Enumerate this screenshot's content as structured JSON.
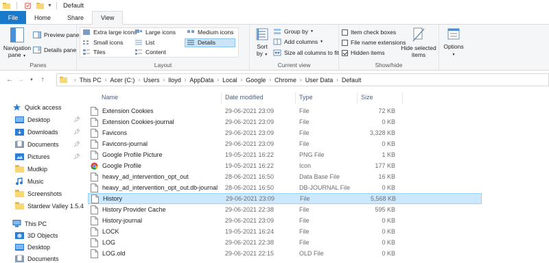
{
  "window": {
    "title": "Default"
  },
  "tabs": {
    "file": "File",
    "home": "Home",
    "share": "Share",
    "view": "View"
  },
  "ribbon": {
    "panes": {
      "label": "Panes",
      "navigation_pane": "Navigation\npane",
      "preview_pane": "Preview pane",
      "details_pane": "Details pane"
    },
    "layout": {
      "label": "Layout",
      "options": [
        "Extra large icons",
        "Large icons",
        "Medium icons",
        "Small icons",
        "List",
        "Details",
        "Tiles",
        "Content"
      ],
      "selected": "Details"
    },
    "current_view": {
      "label": "Current view",
      "sort_by": "Sort\nby",
      "group_by": "Group by",
      "add_columns": "Add columns",
      "size_all_columns": "Size all columns to fit"
    },
    "show_hide": {
      "label": "Show/hide",
      "item_check_boxes": {
        "label": "Item check boxes",
        "checked": false
      },
      "file_name_extensions": {
        "label": "File name extensions",
        "checked": false
      },
      "hidden_items": {
        "label": "Hidden items",
        "checked": true
      },
      "hide_selected_items": "Hide selected\nitems"
    },
    "options": {
      "label": "Options"
    }
  },
  "address": {
    "breadcrumbs": [
      "This PC",
      "Acer (C:)",
      "Users",
      "lloyd",
      "AppData",
      "Local",
      "Google",
      "Chrome",
      "User Data",
      "Default"
    ]
  },
  "nav": {
    "quick_access": "Quick access",
    "items": [
      {
        "label": "Desktop",
        "icon": "desktop-folder-icon",
        "pinned": true
      },
      {
        "label": "Downloads",
        "icon": "downloads-folder-icon",
        "pinned": true
      },
      {
        "label": "Documents",
        "icon": "documents-folder-icon",
        "pinned": true
      },
      {
        "label": "Pictures",
        "icon": "pictures-folder-icon",
        "pinned": true
      },
      {
        "label": "Mudkip",
        "icon": "folder-icon",
        "pinned": false
      },
      {
        "label": "Music",
        "icon": "music-icon",
        "pinned": false
      },
      {
        "label": "Screenshots",
        "icon": "folder-icon",
        "pinned": false
      },
      {
        "label": "Stardew Valley 1.5.4",
        "icon": "folder-icon",
        "pinned": false
      }
    ],
    "this_pc": "This PC",
    "pc_items": [
      {
        "label": "3D Objects",
        "icon": "3d-objects-icon"
      },
      {
        "label": "Desktop",
        "icon": "desktop-folder-icon"
      },
      {
        "label": "Documents",
        "icon": "documents-folder-icon"
      }
    ]
  },
  "columns": {
    "name": "Name",
    "date": "Date modified",
    "type": "Type",
    "size": "Size"
  },
  "files": [
    {
      "name": "Extension Cookies",
      "date": "29-06-2021 23:09",
      "type": "File",
      "size": "72 KB",
      "icon": "file-icon"
    },
    {
      "name": "Extension Cookies-journal",
      "date": "29-06-2021 23:09",
      "type": "File",
      "size": "0 KB",
      "icon": "file-icon"
    },
    {
      "name": "Favicons",
      "date": "29-06-2021 23:09",
      "type": "File",
      "size": "3,328 KB",
      "icon": "file-icon"
    },
    {
      "name": "Favicons-journal",
      "date": "29-06-2021 23:09",
      "type": "File",
      "size": "0 KB",
      "icon": "file-icon"
    },
    {
      "name": "Google Profile Picture",
      "date": "19-05-2021 16:22",
      "type": "PNG File",
      "size": "1 KB",
      "icon": "file-icon"
    },
    {
      "name": "Google Profile",
      "date": "19-05-2021 16:22",
      "type": "Icon",
      "size": "177 KB",
      "icon": "chrome-icon"
    },
    {
      "name": "heavy_ad_intervention_opt_out",
      "date": "28-06-2021 16:50",
      "type": "Data Base File",
      "size": "16 KB",
      "icon": "file-icon"
    },
    {
      "name": "heavy_ad_intervention_opt_out.db-journal",
      "date": "28-06-2021 16:50",
      "type": "DB-JOURNAL File",
      "size": "0 KB",
      "icon": "file-icon"
    },
    {
      "name": "History",
      "date": "29-06-2021 23:09",
      "type": "File",
      "size": "5,568 KB",
      "icon": "file-icon",
      "selected": true
    },
    {
      "name": "History Provider Cache",
      "date": "29-06-2021 22:38",
      "type": "File",
      "size": "595 KB",
      "icon": "file-icon"
    },
    {
      "name": "History-journal",
      "date": "29-06-2021 23:09",
      "type": "File",
      "size": "0 KB",
      "icon": "file-icon"
    },
    {
      "name": "LOCK",
      "date": "19-05-2021 16:24",
      "type": "File",
      "size": "0 KB",
      "icon": "file-icon"
    },
    {
      "name": "LOG",
      "date": "29-06-2021 22:38",
      "type": "File",
      "size": "0 KB",
      "icon": "file-icon"
    },
    {
      "name": "LOG.old",
      "date": "29-06-2021 22:15",
      "type": "OLD File",
      "size": "0 KB",
      "icon": "file-icon"
    }
  ],
  "colors": {
    "accent": "#1979ca",
    "folder": "#f8d775",
    "selection": "#cce8ff"
  }
}
